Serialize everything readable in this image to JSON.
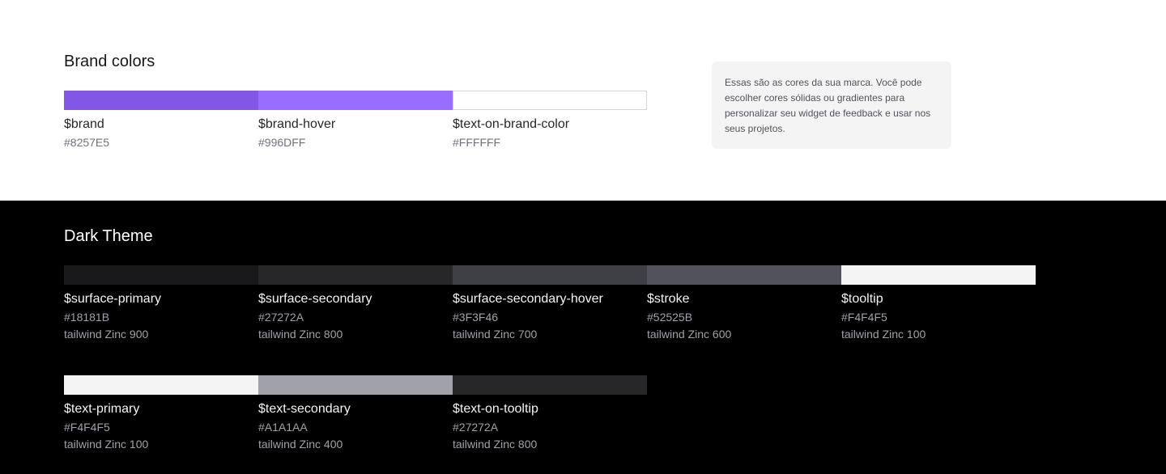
{
  "brand": {
    "title": "Brand colors",
    "note": "Essas são as cores da sua marca. Você pode escolher cores sólidas ou gradientes para personalizar seu widget de feedback e usar nos seus projetos.",
    "swatches": [
      {
        "name": "$brand",
        "hex": "#8257E5",
        "color": "#8257E5"
      },
      {
        "name": "$brand-hover",
        "hex": "#996DFF",
        "color": "#996DFF"
      },
      {
        "name": "$text-on-brand-color",
        "hex": "#FFFFFF",
        "color": "#FFFFFF"
      }
    ]
  },
  "dark_theme": {
    "title": "Dark Theme",
    "row1": [
      {
        "name": "$surface-primary",
        "hex": "#18181B",
        "tailwind": "tailwind Zinc 900",
        "color": "#18181B"
      },
      {
        "name": "$surface-secondary",
        "hex": "#27272A",
        "tailwind": "tailwind Zinc 800",
        "color": "#27272A"
      },
      {
        "name": "$surface-secondary-hover",
        "hex": "#3F3F46",
        "tailwind": "tailwind Zinc 700",
        "color": "#3F3F46"
      },
      {
        "name": "$stroke",
        "hex": "#52525B",
        "tailwind": "tailwind Zinc 600",
        "color": "#52525B"
      },
      {
        "name": "$tooltip",
        "hex": "#F4F4F5",
        "tailwind": "tailwind Zinc 100",
        "color": "#F4F4F5"
      }
    ],
    "row2": [
      {
        "name": "$text-primary",
        "hex": "#F4F4F5",
        "tailwind": "tailwind Zinc 100",
        "color": "#F4F4F5"
      },
      {
        "name": "$text-secondary",
        "hex": "#A1A1AA",
        "tailwind": "tailwind Zinc 400",
        "color": "#A1A1AA"
      },
      {
        "name": "$text-on-tooltip",
        "hex": "#27272A",
        "tailwind": "tailwind Zinc 800",
        "color": "#27272A"
      }
    ]
  }
}
